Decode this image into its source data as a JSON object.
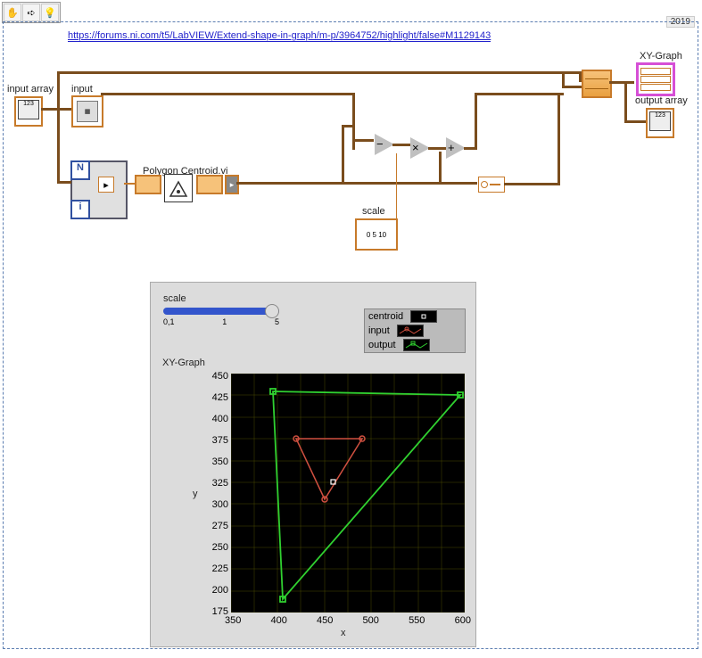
{
  "toolbar": {
    "hand": "✋",
    "arrow": "➪",
    "bulb": "💡"
  },
  "year": "2019",
  "url": "https://forums.ni.com/t5/LabVIEW/Extend-shape-in-graph/m-p/3964752/highlight/false#M1129143",
  "labels": {
    "input_array": "input array",
    "input": "input",
    "polygon_centroid": "Polygon Centroid.vi",
    "scale": "scale",
    "xy_graph": "XY-Graph",
    "output_array": "output array",
    "forloop_N": "N",
    "forloop_i": "i"
  },
  "ops": {
    "sub": "−",
    "mul": "×",
    "add": "+"
  },
  "slider": {
    "title": "scale",
    "ticks": [
      "0,1",
      "1",
      "5"
    ]
  },
  "legend": {
    "items": [
      {
        "name": "centroid"
      },
      {
        "name": "input"
      },
      {
        "name": "output"
      }
    ]
  },
  "plot": {
    "title": "XY-Graph",
    "xlabel": "x",
    "ylabel": "y",
    "x_ticks": [
      "350",
      "400",
      "450",
      "500",
      "550",
      "600"
    ],
    "y_ticks": [
      "450",
      "425",
      "400",
      "375",
      "350",
      "325",
      "300",
      "275",
      "250",
      "225",
      "200",
      "175"
    ]
  },
  "chart_data": {
    "type": "line",
    "title": "XY-Graph",
    "xlabel": "x",
    "ylabel": "y",
    "xlim": [
      350,
      600
    ],
    "ylim": [
      175,
      450
    ],
    "series": [
      {
        "name": "centroid",
        "type": "scatter",
        "color": "#ffffff",
        "x": [
          460
        ],
        "y": [
          325
        ]
      },
      {
        "name": "input",
        "type": "line",
        "color": "#d05040",
        "closed": true,
        "x": [
          420,
          490,
          450,
          420
        ],
        "y": [
          375,
          375,
          305,
          375
        ]
      },
      {
        "name": "output",
        "type": "line",
        "color": "#30d030",
        "closed": true,
        "x": [
          395,
          595,
          405,
          395
        ],
        "y": [
          430,
          425,
          190,
          430
        ]
      }
    ]
  }
}
